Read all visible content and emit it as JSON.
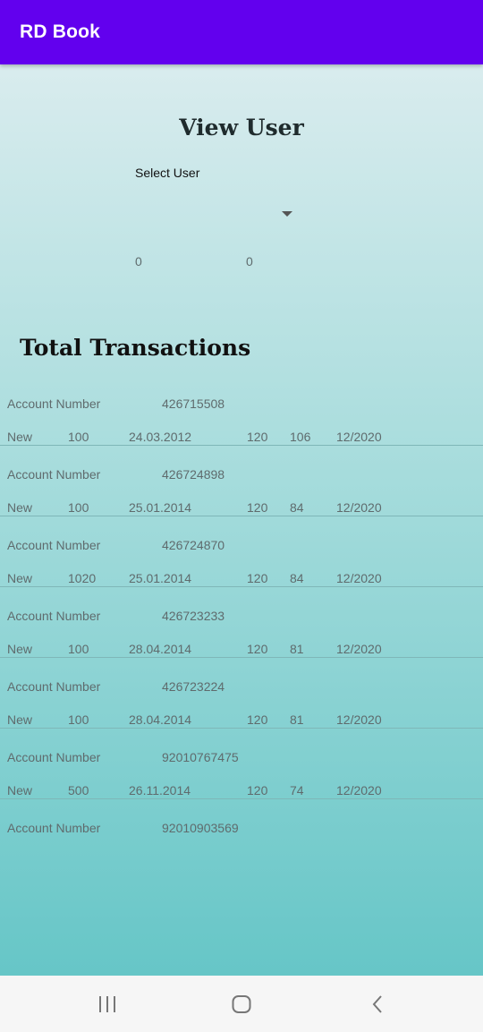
{
  "app": {
    "title": "RD Book"
  },
  "view_user": {
    "title": "View User",
    "select_label": "Select User",
    "value_a": "0",
    "value_b": "0"
  },
  "transactions": {
    "title": "Total Transactions",
    "items": [
      {
        "account_label": "Account Number",
        "account_number": "426715508",
        "type": "New",
        "amount": "100",
        "date": "24.03.2012",
        "months": "120",
        "remaining": "106",
        "maturity": "12/2020"
      },
      {
        "account_label": "Account Number",
        "account_number": "426724898",
        "type": "New",
        "amount": "100",
        "date": "25.01.2014",
        "months": "120",
        "remaining": "84",
        "maturity": "12/2020"
      },
      {
        "account_label": "Account Number",
        "account_number": "426724870",
        "type": "New",
        "amount": "1020",
        "date": "25.01.2014",
        "months": "120",
        "remaining": "84",
        "maturity": "12/2020"
      },
      {
        "account_label": "Account Number",
        "account_number": "426723233",
        "type": "New",
        "amount": "100",
        "date": "28.04.2014",
        "months": "120",
        "remaining": "81",
        "maturity": "12/2020"
      },
      {
        "account_label": "Account Number",
        "account_number": "426723224",
        "type": "New",
        "amount": "100",
        "date": "28.04.2014",
        "months": "120",
        "remaining": "81",
        "maturity": "12/2020"
      },
      {
        "account_label": "Account Number",
        "account_number": "92010767475",
        "type": "New",
        "amount": "500",
        "date": "26.11.2014",
        "months": "120",
        "remaining": "74",
        "maturity": "12/2020"
      },
      {
        "account_label": "Account Number",
        "account_number": "92010903569"
      }
    ]
  },
  "navbar": {
    "recents_icon": "recents-icon",
    "home_icon": "home-icon",
    "back_icon": "back-icon"
  },
  "colors": {
    "appbar": "#6200ee",
    "gradient_top": "#d9ecee",
    "gradient_bottom": "#66c6c7"
  }
}
